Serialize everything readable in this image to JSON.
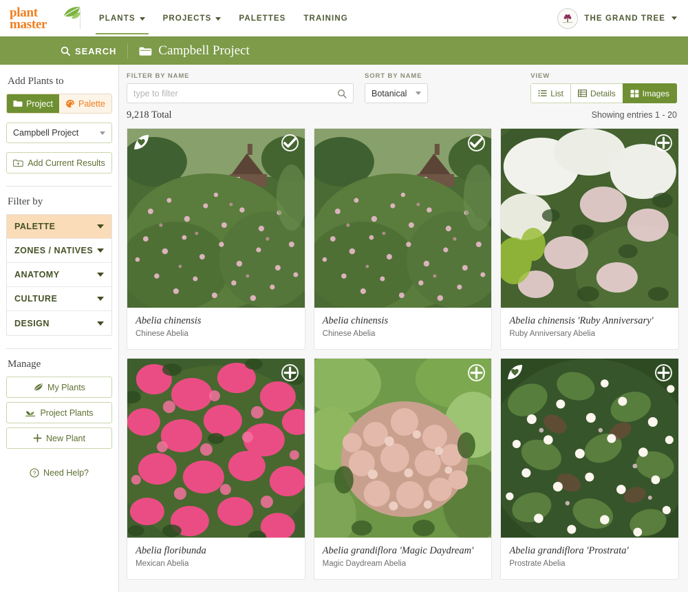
{
  "topnav": {
    "logo_line1": "plant",
    "logo_line2": "master",
    "logo_icon": "leaf-icon",
    "items": [
      {
        "label": "PLANTS",
        "has_caret": true,
        "active": true
      },
      {
        "label": "PROJECTS",
        "has_caret": true,
        "active": false
      },
      {
        "label": "PALETTES",
        "has_caret": false,
        "active": false
      },
      {
        "label": "TRAINING",
        "has_caret": false,
        "active": false
      }
    ],
    "account_name": "THE GRAND TREE",
    "account_avatar": "tree-logo-avatar",
    "account_caret": "chevron-down-icon"
  },
  "greenbar": {
    "search_label": "SEARCH",
    "search_icon": "search-icon",
    "project_icon": "folder-icon",
    "project_name": "Campbell Project",
    "accent_color": "#7d9b49"
  },
  "sidebar": {
    "add_plants_heading": "Add Plants to",
    "toggle": {
      "project_label": "Project",
      "project_icon": "folder-icon",
      "palette_label": "Palette",
      "palette_icon": "palette-icon",
      "selected": "Project"
    },
    "project_select_value": "Campbell Project",
    "add_results_label": "Add Current Results",
    "add_results_icon": "folder-plus-icon",
    "filter_heading": "Filter by",
    "filters": [
      {
        "label": "PALETTE",
        "highlighted": true
      },
      {
        "label": "ZONES / NATIVES",
        "highlighted": false
      },
      {
        "label": "ANATOMY",
        "highlighted": false
      },
      {
        "label": "CULTURE",
        "highlighted": false
      },
      {
        "label": "DESIGN",
        "highlighted": false
      }
    ],
    "manage_heading": "Manage",
    "manage_buttons": [
      {
        "label": "My Plants",
        "icon": "leaf-icon"
      },
      {
        "label": "Project Plants",
        "icon": "seedling-icon"
      },
      {
        "label": "New Plant",
        "icon": "plus-icon"
      }
    ],
    "need_help_label": "Need Help?",
    "need_help_icon": "question-circle-icon"
  },
  "toolbar": {
    "filter_label": "FILTER BY NAME",
    "filter_placeholder": "type to filter",
    "filter_value": "",
    "filter_icon": "search-icon",
    "sort_label": "SORT BY NAME",
    "sort_value": "Botanical",
    "view_label": "VIEW",
    "views": [
      {
        "label": "List",
        "icon": "list-icon",
        "active": false
      },
      {
        "label": "Details",
        "icon": "table-icon",
        "active": false
      },
      {
        "label": "Images",
        "icon": "grid-icon",
        "active": true
      }
    ]
  },
  "results": {
    "total_text": "9,218 Total",
    "showing_text": "Showing entries 1 - 20"
  },
  "cards": [
    {
      "botanical": "Abelia chinensis",
      "common": "Chinese Abelia",
      "badge_leaf": true,
      "badge_circle": "check",
      "photo": "abelia-chinensis-shrub"
    },
    {
      "botanical": "Abelia chinensis",
      "common": "Chinese Abelia",
      "badge_leaf": false,
      "badge_circle": "check",
      "photo": "abelia-chinensis-shrub-2"
    },
    {
      "botanical": "Abelia chinensis 'Ruby Anniversary'",
      "common": "Ruby Anniversary Abelia",
      "badge_leaf": false,
      "badge_circle": "plus",
      "photo": "abelia-ruby-anniversary-white-blooms"
    },
    {
      "botanical": "Abelia floribunda",
      "common": "Mexican Abelia",
      "badge_leaf": false,
      "badge_circle": "plus",
      "photo": "abelia-floribunda-pink-blooms"
    },
    {
      "botanical": "Abelia grandiflora 'Magic Daydream'",
      "common": "Magic Daydream Abelia",
      "badge_leaf": false,
      "badge_circle": "plus",
      "photo": "abelia-magic-daydream-mound"
    },
    {
      "botanical": "Abelia grandiflora 'Prostrata'",
      "common": "Prostrate Abelia",
      "badge_leaf": true,
      "badge_circle": "plus",
      "photo": "abelia-prostrata-white-blooms"
    }
  ]
}
